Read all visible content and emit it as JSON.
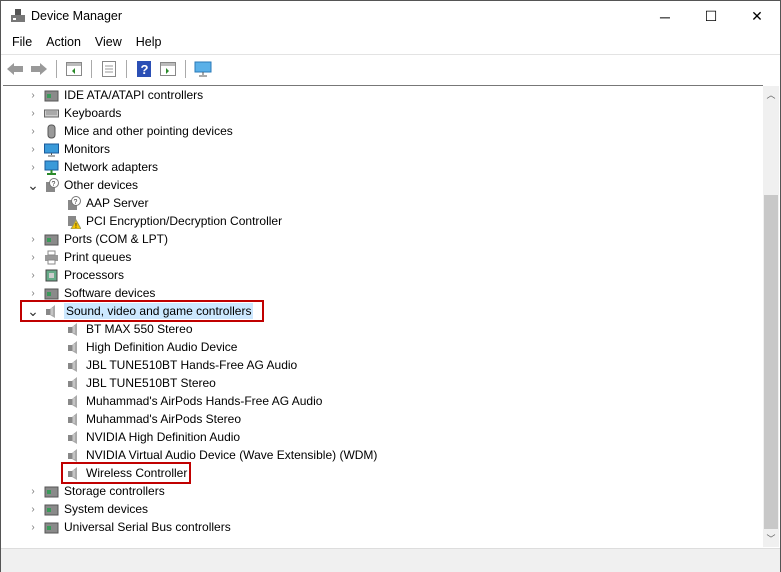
{
  "window": {
    "title": "Device Manager",
    "minimize": "─",
    "maximize": "☐",
    "close": "✕"
  },
  "menu": [
    "File",
    "Action",
    "View",
    "Help"
  ],
  "toolbar": [
    "back-icon",
    "forward-icon",
    "show-hide-console-tree-icon",
    "properties-icon",
    "help-icon",
    "action-pane-icon",
    "scan-hardware-icon"
  ],
  "tree": [
    {
      "label": "IDE ATA/ATAPI controllers",
      "level": 0,
      "state": "collapsed",
      "icon": "ide-icon"
    },
    {
      "label": "Keyboards",
      "level": 0,
      "state": "collapsed",
      "icon": "keyboard-icon"
    },
    {
      "label": "Mice and other pointing devices",
      "level": 0,
      "state": "collapsed",
      "icon": "mouse-icon"
    },
    {
      "label": "Monitors",
      "level": 0,
      "state": "collapsed",
      "icon": "monitor-icon"
    },
    {
      "label": "Network adapters",
      "level": 0,
      "state": "collapsed",
      "icon": "network-icon"
    },
    {
      "label": "Other devices",
      "level": 0,
      "state": "expanded",
      "icon": "unknown-device-icon"
    },
    {
      "label": "AAP Server",
      "level": 1,
      "icon": "unknown-device-icon"
    },
    {
      "label": "PCI Encryption/Decryption Controller",
      "level": 1,
      "icon": "warning-device-icon"
    },
    {
      "label": "Ports (COM & LPT)",
      "level": 0,
      "state": "collapsed",
      "icon": "port-icon"
    },
    {
      "label": "Print queues",
      "level": 0,
      "state": "collapsed",
      "icon": "printer-icon"
    },
    {
      "label": "Processors",
      "level": 0,
      "state": "collapsed",
      "icon": "processor-icon"
    },
    {
      "label": "Software devices",
      "level": 0,
      "state": "collapsed",
      "icon": "software-icon"
    },
    {
      "label": "Sound, video and game controllers",
      "level": 0,
      "state": "expanded",
      "icon": "speaker-icon",
      "selected": true,
      "highlighted": true
    },
    {
      "label": "BT MAX 550 Stereo",
      "level": 1,
      "icon": "speaker-icon"
    },
    {
      "label": "High Definition Audio Device",
      "level": 1,
      "icon": "speaker-icon"
    },
    {
      "label": "JBL TUNE510BT Hands-Free AG Audio",
      "level": 1,
      "icon": "speaker-icon"
    },
    {
      "label": "JBL TUNE510BT Stereo",
      "level": 1,
      "icon": "speaker-icon"
    },
    {
      "label": "Muhammad's AirPods Hands-Free AG Audio",
      "level": 1,
      "icon": "speaker-icon"
    },
    {
      "label": "Muhammad's AirPods Stereo",
      "level": 1,
      "icon": "speaker-icon"
    },
    {
      "label": "NVIDIA High Definition Audio",
      "level": 1,
      "icon": "speaker-icon"
    },
    {
      "label": "NVIDIA Virtual Audio Device (Wave Extensible) (WDM)",
      "level": 1,
      "icon": "speaker-icon"
    },
    {
      "label": "Wireless Controller",
      "level": 1,
      "icon": "speaker-icon",
      "highlighted": true
    },
    {
      "label": "Storage controllers",
      "level": 0,
      "state": "collapsed",
      "icon": "storage-icon"
    },
    {
      "label": "System devices",
      "level": 0,
      "state": "collapsed",
      "icon": "system-icon"
    },
    {
      "label": "Universal Serial Bus controllers",
      "level": 0,
      "state": "collapsed",
      "icon": "usb-icon"
    }
  ],
  "colors": {
    "highlight": "#c00000",
    "selection": "#cce8ff"
  }
}
